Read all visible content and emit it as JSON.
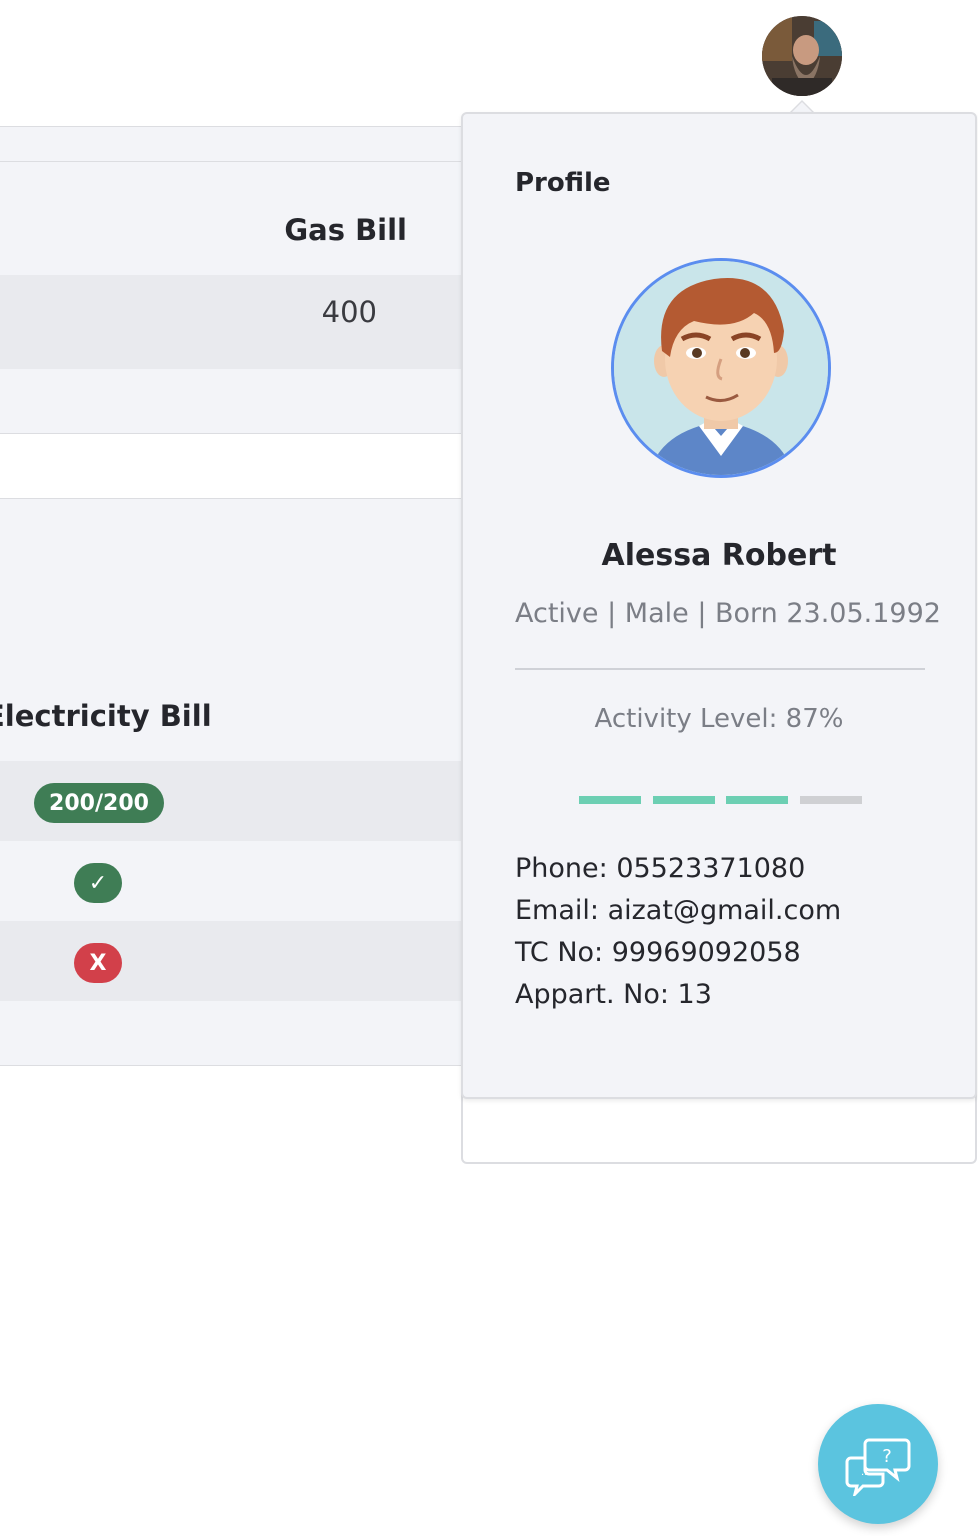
{
  "table1": {
    "header": "Gas Bill",
    "rows": [
      "400"
    ]
  },
  "table2": {
    "header": "Electricity Bill",
    "badges": [
      "200/200",
      "✓",
      "X"
    ]
  },
  "profile": {
    "title": "Profile",
    "name": "Alessa Robert",
    "meta": "Active | Male | Born 23.05.1992",
    "activity_label": "Activity Level: 87%",
    "activity_level_percent": 87,
    "bar_colors": {
      "filled": "#6ccfb3",
      "empty": "#cfd0d3"
    },
    "phone": "Phone: 05523371080",
    "email": "Email: aizat@gmail.com",
    "tc": "TC No: 99969092058",
    "appart": "Appart. No: 13"
  },
  "colors": {
    "accent_blue": "#5b8def",
    "success": "#3f7d55",
    "danger": "#d2404a",
    "help_button": "#5bc4df"
  },
  "icons": {
    "help": "chat-help-icon",
    "check": "check-icon",
    "close": "x-icon"
  }
}
